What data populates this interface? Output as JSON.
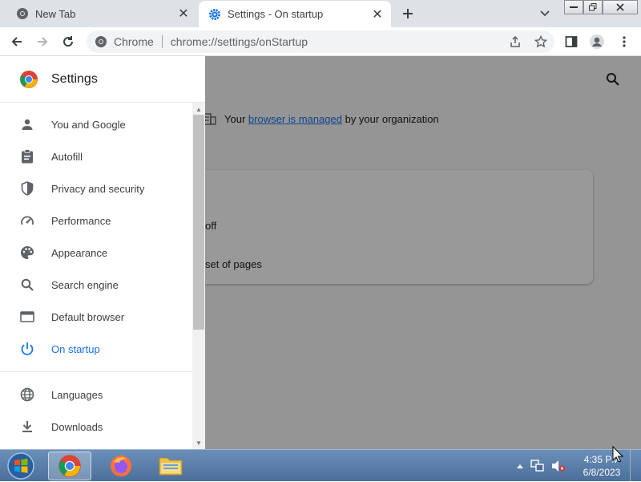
{
  "tabs": [
    {
      "title": "New Tab",
      "icon": "chrome-icon",
      "active": false
    },
    {
      "title": "Settings - On startup",
      "icon": "settings-gear-icon",
      "active": true
    }
  ],
  "toolbar": {
    "site_chip": "Chrome",
    "url": "chrome://settings/onStartup"
  },
  "drawer": {
    "title": "Settings",
    "items": [
      {
        "label": "You and Google",
        "icon": "person-icon"
      },
      {
        "label": "Autofill",
        "icon": "clipboard-icon"
      },
      {
        "label": "Privacy and security",
        "icon": "shield-icon"
      },
      {
        "label": "Performance",
        "icon": "speedometer-icon"
      },
      {
        "label": "Appearance",
        "icon": "palette-icon"
      },
      {
        "label": "Search engine",
        "icon": "search-icon"
      },
      {
        "label": "Default browser",
        "icon": "browser-window-icon"
      },
      {
        "label": "On startup",
        "icon": "power-icon",
        "active": true
      },
      {
        "label": "Languages",
        "icon": "globe-icon"
      },
      {
        "label": "Downloads",
        "icon": "download-icon"
      }
    ]
  },
  "main": {
    "managed_prefix": "Your",
    "managed_link": "browser is managed",
    "managed_suffix": "by your organization",
    "option_1_fragment": "off",
    "option_2_fragment": "set of pages"
  },
  "taskbar": {
    "time": "4:35 PM",
    "date": "6/8/2023"
  },
  "colors": {
    "accent": "#1a73e8",
    "tabstrip": "#dee1e6",
    "taskbar": "#4b6f9a"
  }
}
